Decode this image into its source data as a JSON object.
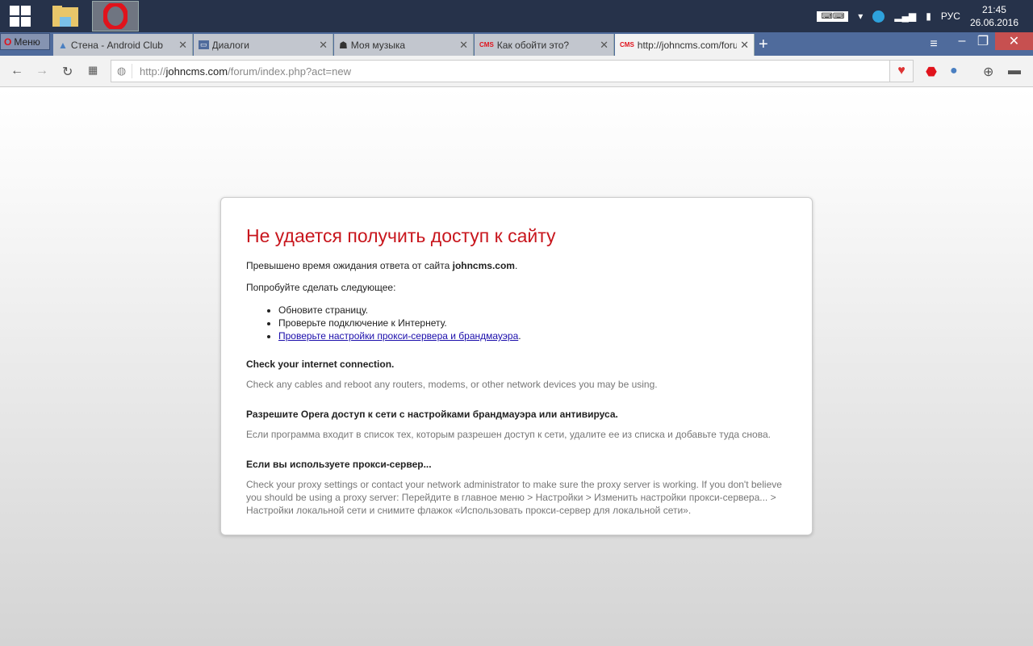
{
  "taskbar": {
    "tray": {
      "lang": "РУС",
      "time": "21:45",
      "date": "26.06.2016"
    }
  },
  "browser": {
    "menu_label": "Меню",
    "tabs": [
      {
        "label": "Стена - Android Club"
      },
      {
        "label": "Диалоги"
      },
      {
        "label": "Моя музыка"
      },
      {
        "label": "Как обойти это?"
      },
      {
        "label": "http://johncms.com/forum/index.php?act=new"
      }
    ],
    "address": {
      "scheme": "http://",
      "host": "johncms.com",
      "path": "/forum/index.php?act=new"
    }
  },
  "error": {
    "title": "Не удается получить доступ к сайту",
    "timeout_prefix": "Превышено время ожидания ответа от сайта ",
    "timeout_host": "johncms.com",
    "try_label": "Попробуйте сделать следующее:",
    "suggestions": [
      "Обновите страницу.",
      "Проверьте подключение к Интернету."
    ],
    "proxy_link": "Проверьте настройки прокси-сервера и брандмауэра",
    "sections": [
      {
        "heading": "Check your internet connection.",
        "text": "Check any cables and reboot any routers, modems, or other network devices you may be using."
      },
      {
        "heading": "Разрешите Opera доступ к сети с настройками брандмауэра или антивируса.",
        "text": "Если программа входит в список тех, которым разрешен доступ к сети, удалите ее из списка и добавьте туда снова."
      },
      {
        "heading": "Если вы используете прокси-сервер...",
        "text": "Check your proxy settings or contact your network administrator to make sure the proxy server is working. If you don't believe you should be using a proxy server: Перейдите в главное меню > Настройки > Изменить настройки прокси-сервера... > Настройки локальной сети и снимите флажок «Использовать прокси-сервер для локальной сети»."
      }
    ]
  }
}
